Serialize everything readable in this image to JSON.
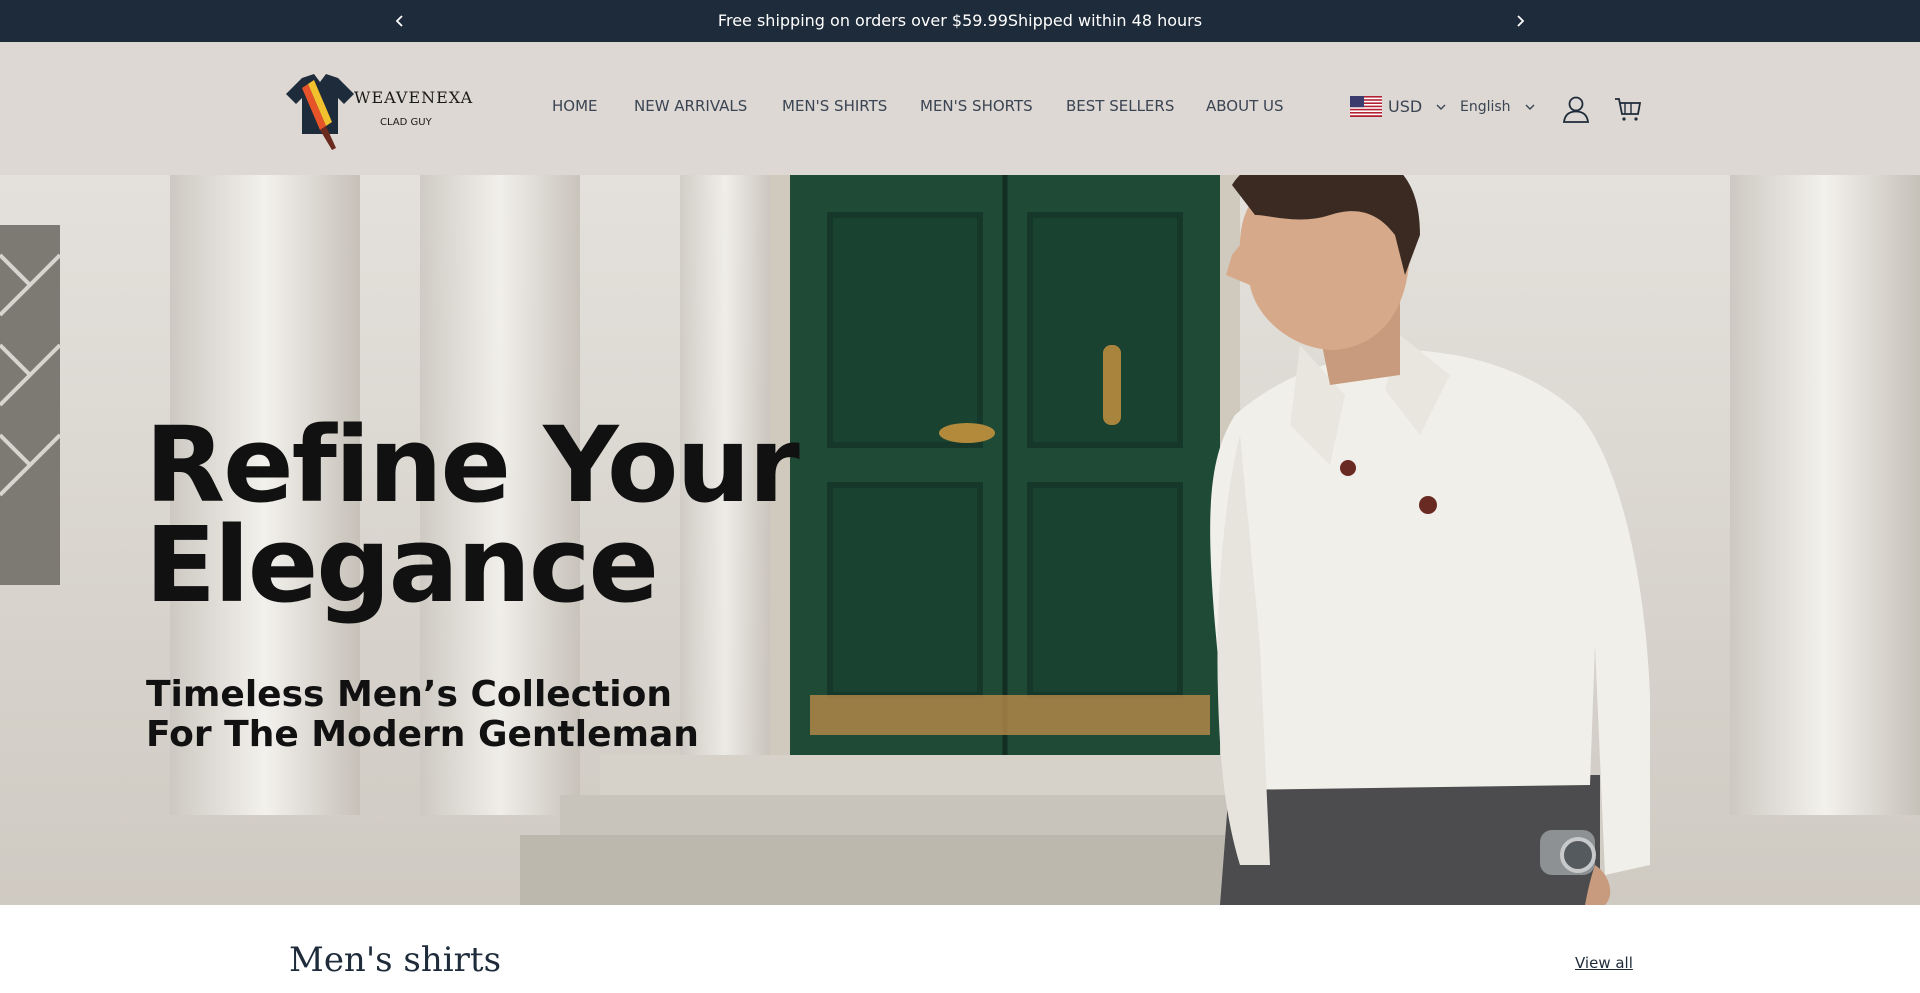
{
  "announcement": {
    "text": "Free shipping on orders over $59.99Shipped within 48 hours"
  },
  "header": {
    "logo": {
      "brand": "WEAVENEXA",
      "tagline": "CLAD GUY"
    },
    "nav": [
      {
        "label": "HOME"
      },
      {
        "label": "NEW ARRIVALS"
      },
      {
        "label": "MEN'S SHIRTS"
      },
      {
        "label": "MEN'S SHORTS"
      },
      {
        "label": "BEST SELLERS"
      },
      {
        "label": "ABOUT US"
      }
    ],
    "currency": "USD",
    "language": "English"
  },
  "hero": {
    "headline": "Refine Your Elegance",
    "subheadline": "Timeless Men’s Collection For The Modern Gentleman"
  },
  "section": {
    "title": "Men's shirts",
    "view_all": "View all"
  },
  "colors": {
    "announcement_bg": "#1e2b3a",
    "header_bg": "#ddd8d3",
    "text_primary": "#1e2b3a"
  }
}
